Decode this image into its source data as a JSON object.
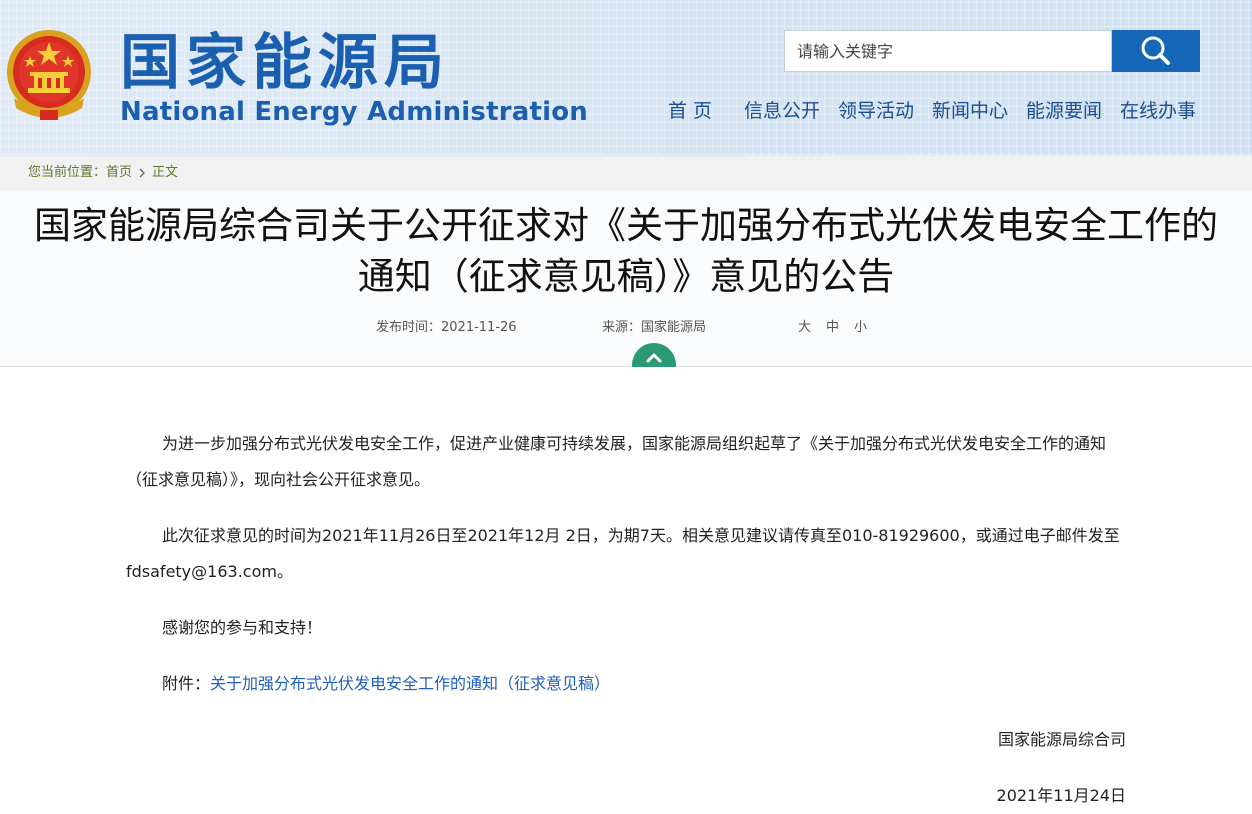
{
  "header": {
    "logo_cn": "国家能源局",
    "logo_en": "National Energy Administration",
    "search_placeholder": "请输入关键字",
    "nav": [
      "首  页",
      "信息公开",
      "领导活动",
      "新闻中心",
      "能源要闻",
      "在线办事"
    ]
  },
  "breadcrumb": {
    "label": "您当前位置：",
    "home": "首页",
    "current": "正文"
  },
  "article": {
    "title": "国家能源局综合司关于公开征求对《关于加强分布式光伏发电安全工作的通知（征求意见稿）》意见的公告",
    "date_label": "发布时间：2021-11-26",
    "source_label": "来源：国家能源局",
    "font_sizes": [
      "大",
      "中",
      "小"
    ],
    "paragraphs": [
      "为进一步加强分布式光伏发电安全工作，促进产业健康可持续发展，国家能源局组织起草了《关于加强分布式光伏发电安全工作的通知（征求意见稿）》，现向社会公开征求意见。",
      "此次征求意见的时间为2021年11月26日至2021年12月 2日，为期7天。相关意见建议请传真至010-81929600，或通过电子邮件发至fdsafety@163.com。",
      "感谢您的参与和支持！"
    ],
    "attachment_label": "附件：",
    "attachment_link": "关于加强分布式光伏发电安全工作的通知（征求意见稿）",
    "signature": "国家能源局综合司",
    "sign_date": "2021年11月24日"
  },
  "colors": {
    "brand_blue": "#1a5fb0",
    "search_button": "#1667b8",
    "collapse_green": "#2a9a73",
    "link_blue": "#1f5fbf"
  },
  "icons": [
    "national-emblem-icon",
    "search-icon",
    "chevron-up-icon",
    "chevron-right-icon"
  ]
}
